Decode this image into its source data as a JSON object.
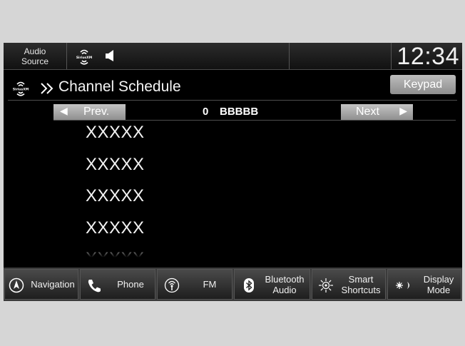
{
  "status_bar": {
    "audio_source_line1": "Audio",
    "audio_source_line2": "Source",
    "clock": "12:34"
  },
  "header": {
    "title": "Channel Schedule",
    "keypad_label": "Keypad"
  },
  "channel_nav": {
    "prev_label": "Prev.",
    "next_label": "Next",
    "channel_number": "0",
    "channel_name": "BBBBB"
  },
  "schedule": {
    "items": [
      "XXXXX",
      "XXXXX",
      "XXXXX",
      "XXXXX"
    ],
    "partial_item": "XXXXX"
  },
  "bottom_nav": {
    "navigation": "Navigation",
    "phone": "Phone",
    "fm": "FM",
    "bluetooth_line1": "Bluetooth",
    "bluetooth_line2": "Audio",
    "smart_line1": "Smart",
    "smart_line2": "Shortcuts",
    "display_line1": "Display",
    "display_line2": "Mode"
  },
  "icons": {
    "siriusxm": "siriusxm-icon",
    "speaker": "speaker-icon",
    "compass": "compass-icon",
    "phone": "phone-icon",
    "fm": "radio-antenna-icon",
    "bluetooth": "bluetooth-icon",
    "smart": "smart-shortcuts-icon",
    "display": "brightness-moon-icon"
  },
  "colors": {
    "screen_bg": "#000000",
    "bezel": "#d6d6d6",
    "button_gray": "#a8a8a8"
  }
}
